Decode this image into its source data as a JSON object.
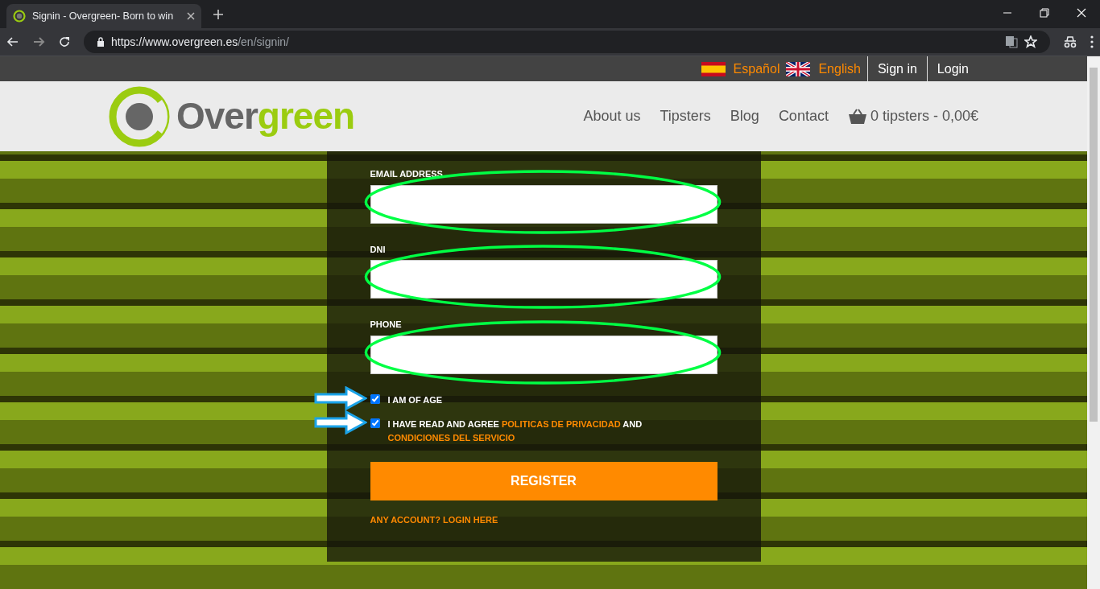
{
  "browser": {
    "tab_title": "Signin - Overgreen- Born to win",
    "url_host": "https://www.overgreen.es",
    "url_path": "/en/signin/"
  },
  "topbar": {
    "languages": [
      {
        "label": "Español",
        "kind": "es"
      },
      {
        "label": "English",
        "kind": "gb"
      }
    ],
    "links": [
      "Sign in",
      "Login"
    ]
  },
  "header": {
    "logo_prefix": "Over",
    "logo_suffix": "green",
    "nav": [
      "About us",
      "Tipsters",
      "Blog",
      "Contact"
    ],
    "cart": "0 tipsters - 0,00€"
  },
  "form": {
    "fields": [
      {
        "label": "EMAIL ADDRESS",
        "circled": true
      },
      {
        "label": "DNI",
        "circled": true
      },
      {
        "label": "PHONE",
        "circled": true
      }
    ],
    "checkboxes": [
      {
        "checked": true,
        "arrow": true,
        "segments": [
          {
            "text": "I AM OF AGE",
            "kind": "plain"
          }
        ]
      },
      {
        "checked": true,
        "arrow": true,
        "segments": [
          {
            "text": "I HAVE READ AND AGREE",
            "kind": "plain"
          },
          {
            "text": "POLITICAS DE PRIVACIDAD",
            "kind": "link"
          },
          {
            "text": "AND",
            "kind": "plain"
          },
          {
            "text": "CONDICIONES DEL SERVICIO",
            "kind": "link"
          }
        ]
      }
    ],
    "submit": "REGISTER",
    "login_link": "ANY ACCOUNT? LOGIN HERE"
  }
}
